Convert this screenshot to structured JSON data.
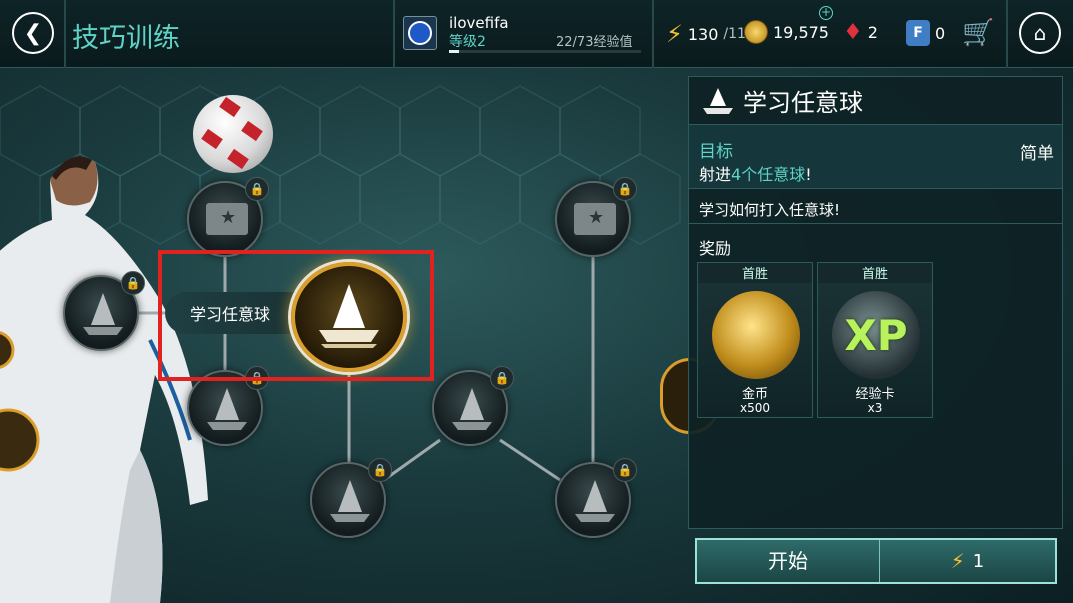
{
  "header": {
    "title": "技巧训练",
    "username": "ilovefifa",
    "level": "等级2",
    "xp_text": "22/73经验值",
    "xp_progress": 0.05,
    "energy_value": "130",
    "energy_max": "/11",
    "coins": "19,575",
    "gems": "2",
    "fifa_points": "0"
  },
  "panel": {
    "title": "学习任意球",
    "goal_label": "目标",
    "difficulty": "简单",
    "goal_prefix": "射进",
    "goal_highlight": "4个任意球",
    "goal_suffix": "!",
    "description": "学习如何打入任意球!",
    "rewards_label": "奖励",
    "rewards": [
      {
        "tag": "首胜",
        "name": "金币",
        "qty": "x500"
      },
      {
        "tag": "首胜",
        "name": "经验卡",
        "qty": "x3"
      }
    ]
  },
  "map": {
    "selected_skill_label": "学习任意球"
  },
  "start": {
    "label": "开始",
    "cost": "1"
  },
  "icons": {
    "back": "back-arrow-icon",
    "home": "home-icon",
    "cart": "shopping-cart-icon",
    "energy": "lightning-bolt-icon",
    "coin": "fifa-coin-icon",
    "gem": "gem-icon",
    "fifa_points": "fifa-points-icon"
  },
  "colors": {
    "accent": "#5fd3c7",
    "highlight_box": "#e0231f",
    "gold": "#d99e2c"
  }
}
